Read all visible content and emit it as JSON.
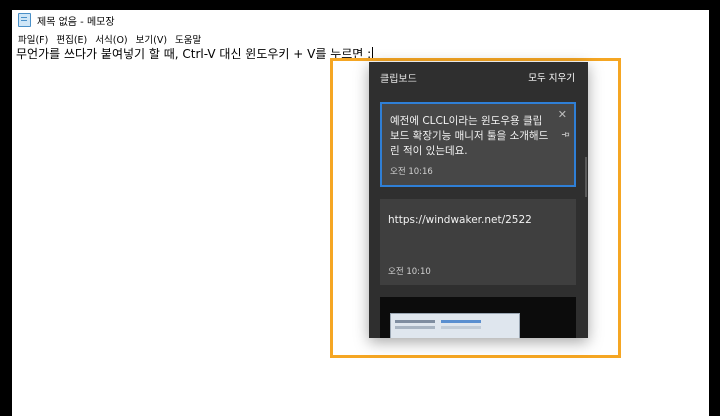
{
  "window": {
    "title": "제목 없음 - 메모장"
  },
  "menu": {
    "items": [
      "파일(F)",
      "편집(E)",
      "서식(O)",
      "보기(V)",
      "도움말"
    ]
  },
  "editor": {
    "text": "무언가를 쓰다가 붙여넣기 할 때, Ctrl-V 대신 윈도우키 + V를 누르면 :"
  },
  "clipboard": {
    "title": "클립보드",
    "clear_all_label": "모두 지우기",
    "items": [
      {
        "text": "예전에 CLCL이라는 윈도우용 클립보드 확장기능 매니저 툴을 소개해드린 적이 있는데요.",
        "time": "오전 10:16"
      },
      {
        "text": "https://windwaker.net/2522",
        "time": "오전 10:10"
      }
    ]
  },
  "colors": {
    "highlight": "#f5a623",
    "selected_border": "#2f7fd6",
    "panel_bg": "#2f2f2f"
  },
  "icons": {
    "close": "close-icon",
    "pin": "pin-icon",
    "app": "notepad-icon"
  }
}
